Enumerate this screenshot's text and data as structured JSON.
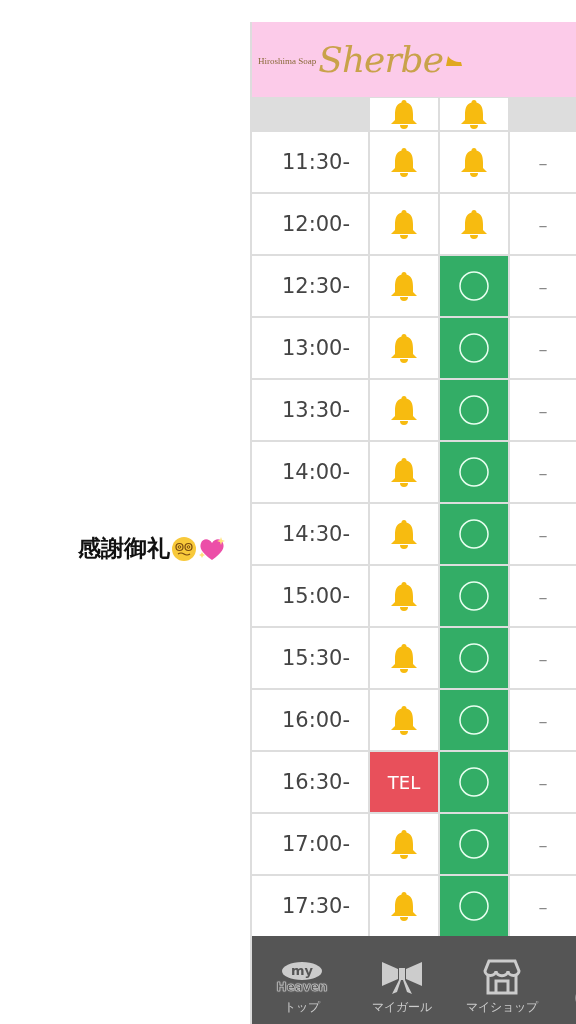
{
  "caption": {
    "text": "感謝御礼"
  },
  "header": {
    "logo_small": "Hiroshima Soap",
    "logo_script": "Sherbe"
  },
  "partial_row": {
    "cells": [
      {
        "kind": "bell"
      },
      {
        "kind": "bell"
      },
      {
        "kind": "empty"
      }
    ]
  },
  "rows": [
    {
      "time": "11:30-",
      "cells": [
        {
          "kind": "bell"
        },
        {
          "kind": "bell"
        },
        {
          "kind": "dash",
          "text": "–"
        }
      ]
    },
    {
      "time": "12:00-",
      "cells": [
        {
          "kind": "bell"
        },
        {
          "kind": "bell"
        },
        {
          "kind": "dash",
          "text": "–"
        }
      ]
    },
    {
      "time": "12:30-",
      "cells": [
        {
          "kind": "bell"
        },
        {
          "kind": "open"
        },
        {
          "kind": "dash",
          "text": "–"
        }
      ]
    },
    {
      "time": "13:00-",
      "cells": [
        {
          "kind": "bell"
        },
        {
          "kind": "open"
        },
        {
          "kind": "dash",
          "text": "–"
        }
      ]
    },
    {
      "time": "13:30-",
      "cells": [
        {
          "kind": "bell"
        },
        {
          "kind": "open"
        },
        {
          "kind": "dash",
          "text": "–"
        }
      ]
    },
    {
      "time": "14:00-",
      "cells": [
        {
          "kind": "bell"
        },
        {
          "kind": "open"
        },
        {
          "kind": "dash",
          "text": "–"
        }
      ]
    },
    {
      "time": "14:30-",
      "cells": [
        {
          "kind": "bell"
        },
        {
          "kind": "open"
        },
        {
          "kind": "dash",
          "text": "–"
        }
      ]
    },
    {
      "time": "15:00-",
      "cells": [
        {
          "kind": "bell"
        },
        {
          "kind": "open"
        },
        {
          "kind": "dash",
          "text": "–"
        }
      ]
    },
    {
      "time": "15:30-",
      "cells": [
        {
          "kind": "bell"
        },
        {
          "kind": "open"
        },
        {
          "kind": "dash",
          "text": "–"
        }
      ]
    },
    {
      "time": "16:00-",
      "cells": [
        {
          "kind": "bell"
        },
        {
          "kind": "open"
        },
        {
          "kind": "dash",
          "text": "–"
        }
      ]
    },
    {
      "time": "16:30-",
      "cells": [
        {
          "kind": "tel",
          "text": "TEL"
        },
        {
          "kind": "open"
        },
        {
          "kind": "dash",
          "text": "–"
        }
      ]
    },
    {
      "time": "17:00-",
      "cells": [
        {
          "kind": "bell"
        },
        {
          "kind": "open"
        },
        {
          "kind": "dash",
          "text": "–"
        }
      ]
    },
    {
      "time": "17:30-",
      "cells": [
        {
          "kind": "bell"
        },
        {
          "kind": "open"
        },
        {
          "kind": "dash",
          "text": "–"
        }
      ]
    }
  ],
  "nav": {
    "logo_top": "my",
    "logo_bottom": "Heaven",
    "items": [
      {
        "kind": "heaven",
        "label": "トップ"
      },
      {
        "kind": "ribbon",
        "label": "マイガール"
      },
      {
        "kind": "shop",
        "label": "マイショップ"
      },
      {
        "kind": "partial"
      }
    ]
  }
}
